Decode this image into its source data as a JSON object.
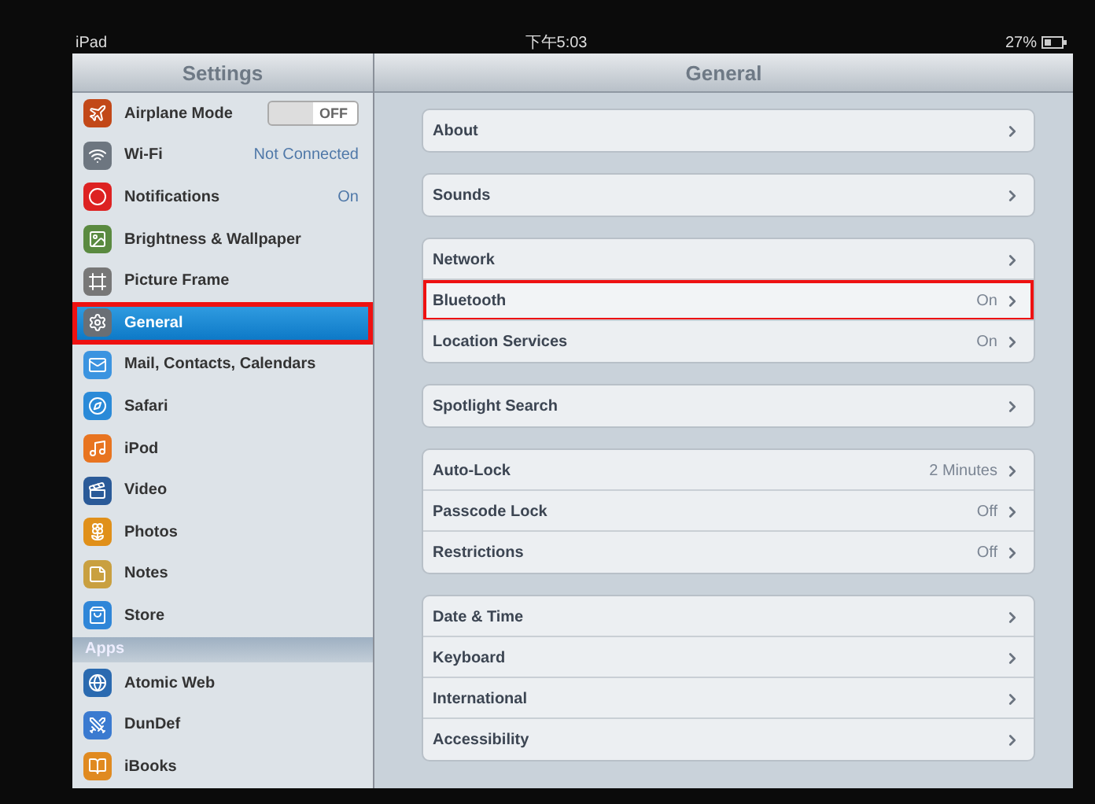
{
  "status_bar": {
    "device": "iPad",
    "time": "下午5:03",
    "battery": "27%"
  },
  "sidebar": {
    "title": "Settings",
    "items": [
      {
        "label": "Airplane Mode",
        "kind": "toggle",
        "on": false,
        "toggle_label": "OFF",
        "selected": false,
        "highlighted": false
      },
      {
        "label": "Wi-Fi",
        "kind": "value",
        "value": "Not Connected",
        "selected": false,
        "highlighted": false
      },
      {
        "label": "Notifications",
        "kind": "value",
        "value": "On",
        "selected": false,
        "highlighted": false
      },
      {
        "label": "Brightness & Wallpaper",
        "kind": "plain",
        "selected": false,
        "highlighted": false
      },
      {
        "label": "Picture Frame",
        "kind": "plain",
        "selected": false,
        "highlighted": false
      },
      {
        "label": "General",
        "kind": "plain",
        "selected": true,
        "highlighted": true
      },
      {
        "label": "Mail, Contacts, Calendars",
        "kind": "plain",
        "selected": false,
        "highlighted": false
      },
      {
        "label": "Safari",
        "kind": "plain",
        "selected": false,
        "highlighted": false
      },
      {
        "label": "iPod",
        "kind": "plain",
        "selected": false,
        "highlighted": false
      },
      {
        "label": "Video",
        "kind": "plain",
        "selected": false,
        "highlighted": false
      },
      {
        "label": "Photos",
        "kind": "plain",
        "selected": false,
        "highlighted": false
      },
      {
        "label": "Notes",
        "kind": "plain",
        "selected": false,
        "highlighted": false
      },
      {
        "label": "Store",
        "kind": "plain",
        "selected": false,
        "highlighted": false
      }
    ],
    "section": "Apps",
    "apps": [
      {
        "label": "Atomic Web",
        "selected": false
      },
      {
        "label": "DunDef",
        "selected": false
      },
      {
        "label": "iBooks",
        "selected": false
      }
    ]
  },
  "detail": {
    "title": "General",
    "groups": [
      [
        {
          "label": "About",
          "highlighted": false
        }
      ],
      [
        {
          "label": "Sounds",
          "highlighted": false
        }
      ],
      [
        {
          "label": "Network",
          "highlighted": false
        },
        {
          "label": "Bluetooth",
          "value": "On",
          "highlighted": true
        },
        {
          "label": "Location Services",
          "value": "On",
          "highlighted": false
        }
      ],
      [
        {
          "label": "Spotlight Search",
          "highlighted": false
        }
      ],
      [
        {
          "label": "Auto-Lock",
          "value": "2 Minutes",
          "highlighted": false
        },
        {
          "label": "Passcode Lock",
          "value": "Off",
          "highlighted": false
        },
        {
          "label": "Restrictions",
          "value": "Off",
          "highlighted": false
        }
      ],
      [
        {
          "label": "Date & Time",
          "highlighted": false
        },
        {
          "label": "Keyboard",
          "highlighted": false
        },
        {
          "label": "International",
          "highlighted": false
        },
        {
          "label": "Accessibility",
          "highlighted": false
        }
      ]
    ]
  }
}
